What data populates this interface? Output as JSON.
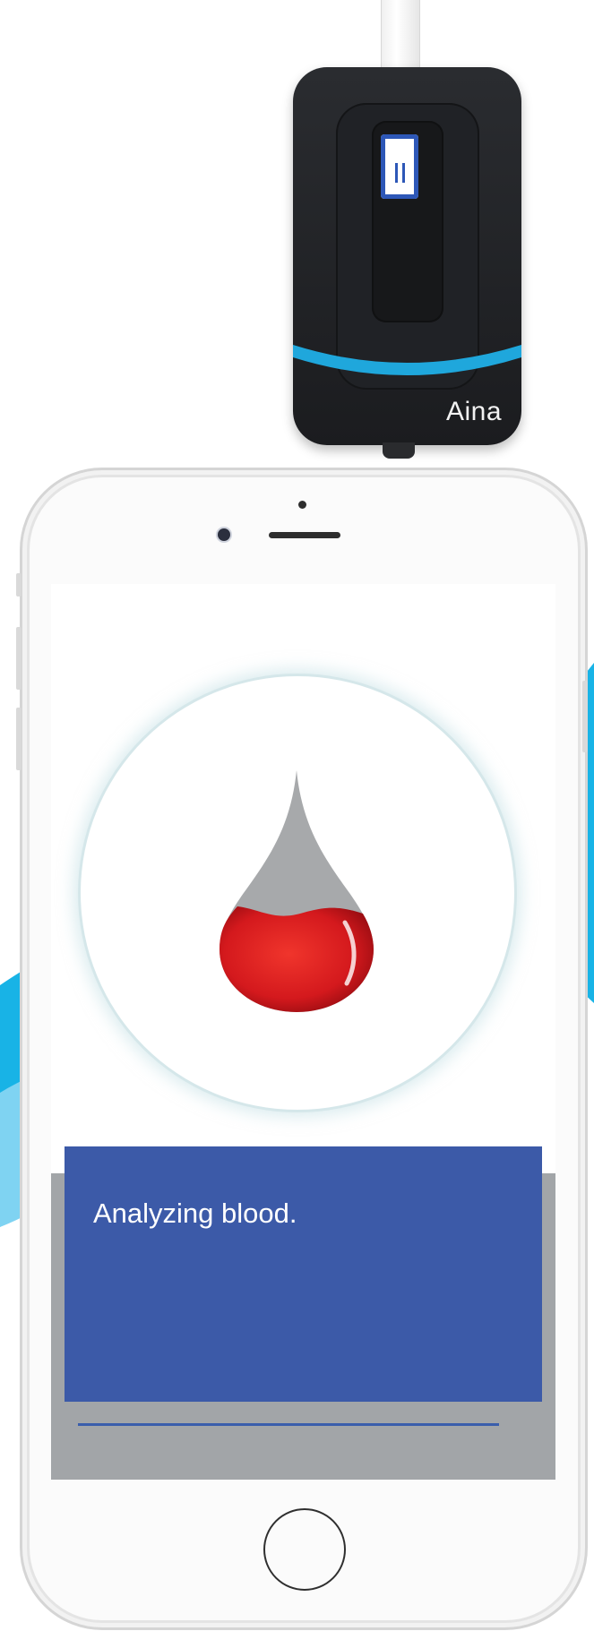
{
  "device": {
    "brand": "Aina",
    "accent_color": "#1fa7dc",
    "strip_color": "#2d57b7"
  },
  "screen": {
    "status_message": "Analyzing blood.",
    "status_color": "#3c5aa8",
    "drop_fill_color": "#d4191d",
    "icons": [
      "blood-drop-icon"
    ]
  }
}
